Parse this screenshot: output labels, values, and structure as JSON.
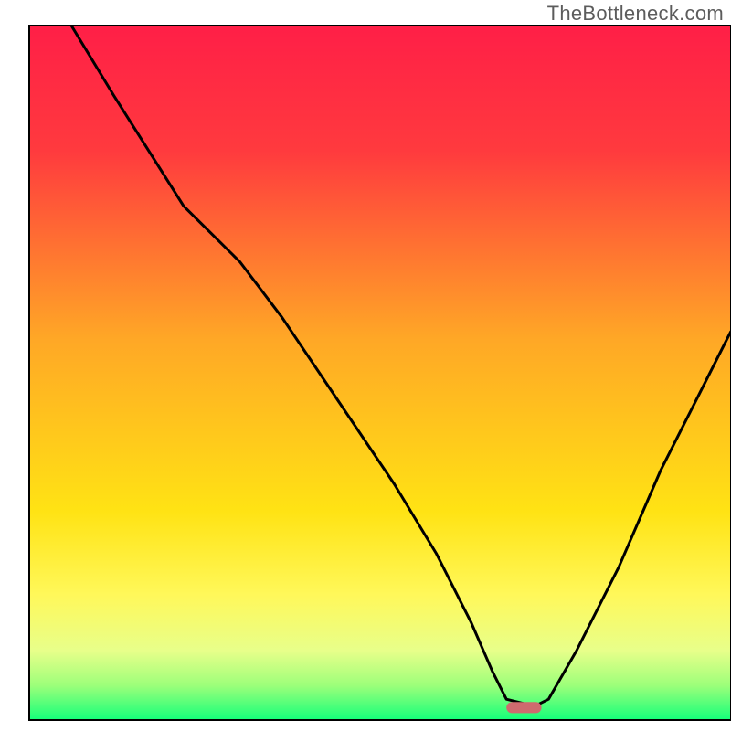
{
  "watermark": {
    "text": "TheBottleneck.com"
  },
  "chart_data": {
    "type": "line",
    "title": "",
    "xlabel": "",
    "ylabel": "",
    "xlim": [
      0,
      100
    ],
    "ylim": [
      0,
      100
    ],
    "grid": false,
    "legend": false,
    "background_gradient": {
      "stops": [
        {
          "offset": 0.0,
          "color": "#ff1f47"
        },
        {
          "offset": 0.18,
          "color": "#ff3a3e"
        },
        {
          "offset": 0.45,
          "color": "#ffa726"
        },
        {
          "offset": 0.7,
          "color": "#ffe314"
        },
        {
          "offset": 0.82,
          "color": "#fff85a"
        },
        {
          "offset": 0.9,
          "color": "#e8ff8a"
        },
        {
          "offset": 0.95,
          "color": "#9dff7a"
        },
        {
          "offset": 1.0,
          "color": "#14ff7a"
        }
      ]
    },
    "series": [
      {
        "name": "bottleneck-curve",
        "color": "#000000",
        "x": [
          6,
          12,
          22,
          30,
          36,
          44,
          52,
          58,
          63,
          66,
          68,
          72,
          74,
          78,
          84,
          90,
          96,
          100
        ],
        "y": [
          100,
          90,
          74,
          66,
          58,
          46,
          34,
          24,
          14,
          7,
          3,
          2,
          3,
          10,
          22,
          36,
          48,
          56
        ]
      }
    ],
    "marker": {
      "name": "optimal-point",
      "shape": "capsule",
      "color": "#cf6a6e",
      "x": 70.5,
      "y": 1.8,
      "width": 5.0,
      "height": 1.6
    },
    "frame": {
      "color": "#000000",
      "width": 2
    }
  }
}
